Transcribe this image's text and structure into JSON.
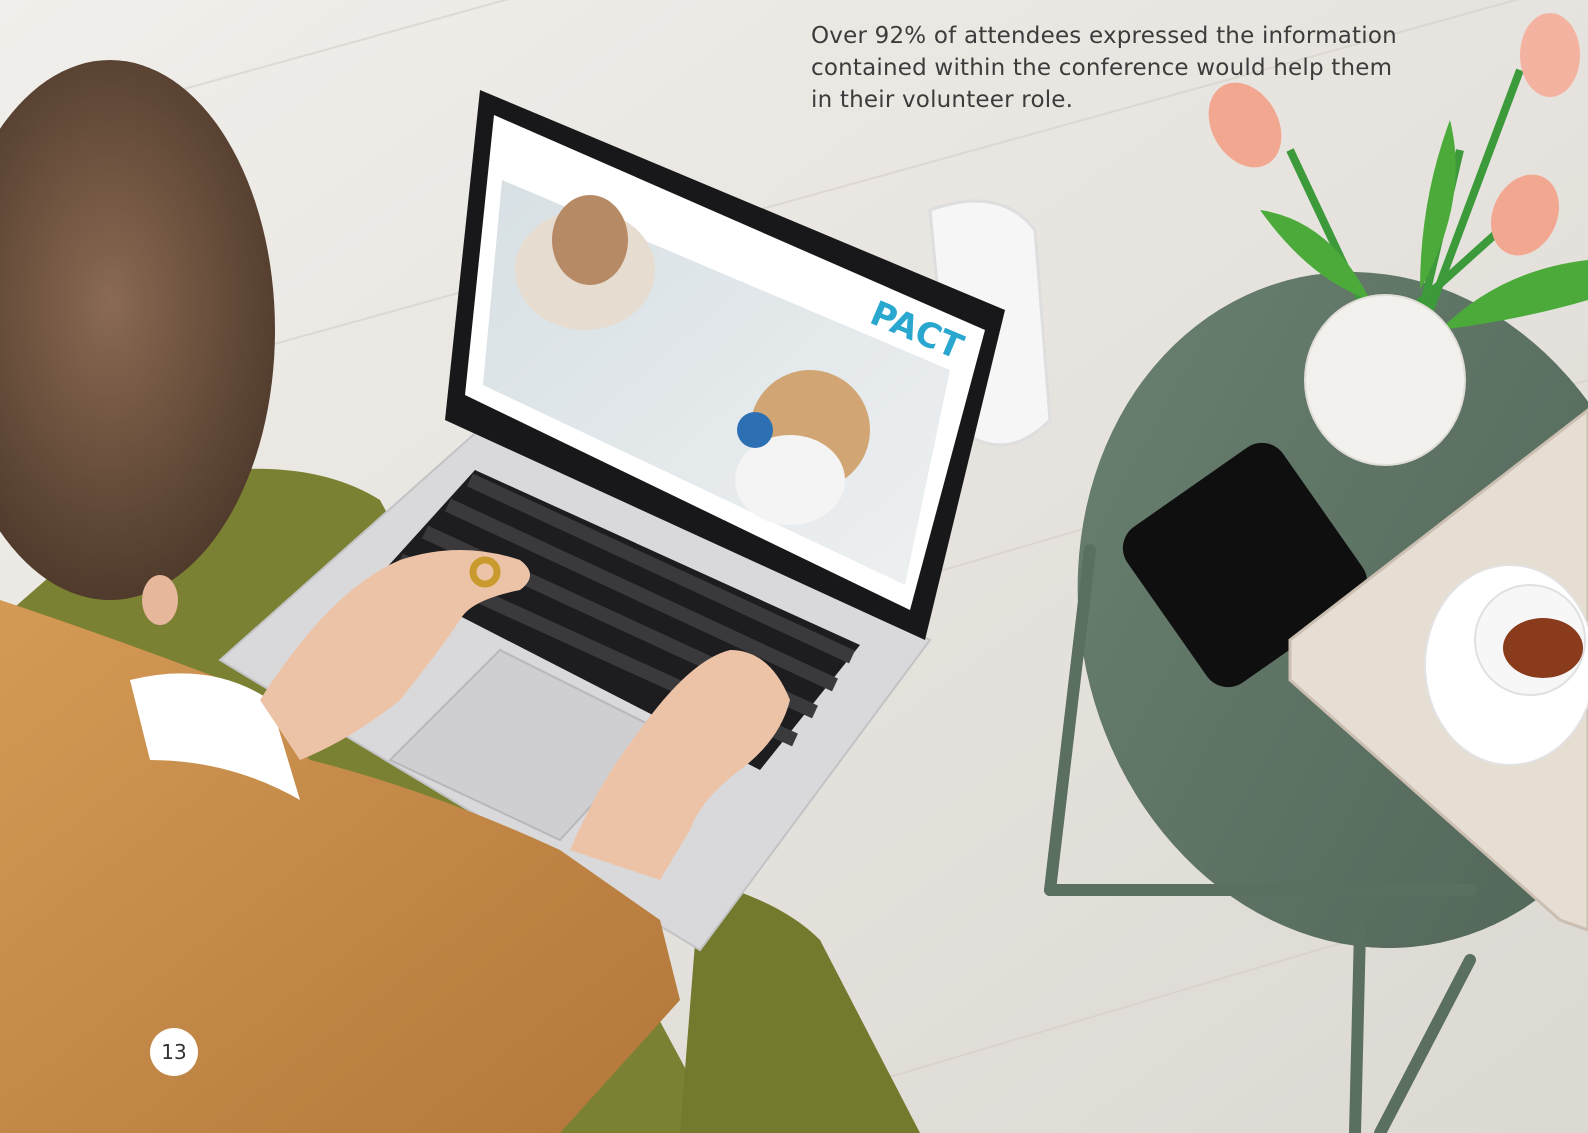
{
  "caption": {
    "lines": [
      "Over 92% of attendees expressed the information",
      "contained within the conference would help them",
      "in their volunteer role."
    ]
  },
  "page_number": "13",
  "photo": {
    "screen_logo": "PACT"
  },
  "colors": {
    "floor": "#e9e6e1",
    "jacket": "#c88a45",
    "sofa": "#7b8132",
    "table": "#5e7465",
    "laptop": "#d9d9db",
    "tulip": "#f2a790",
    "logo_green": "#36a853",
    "logo_blue": "#2aa7cf",
    "logo_orange": "#f39a2b",
    "logo_purple": "#8a4fa3"
  }
}
